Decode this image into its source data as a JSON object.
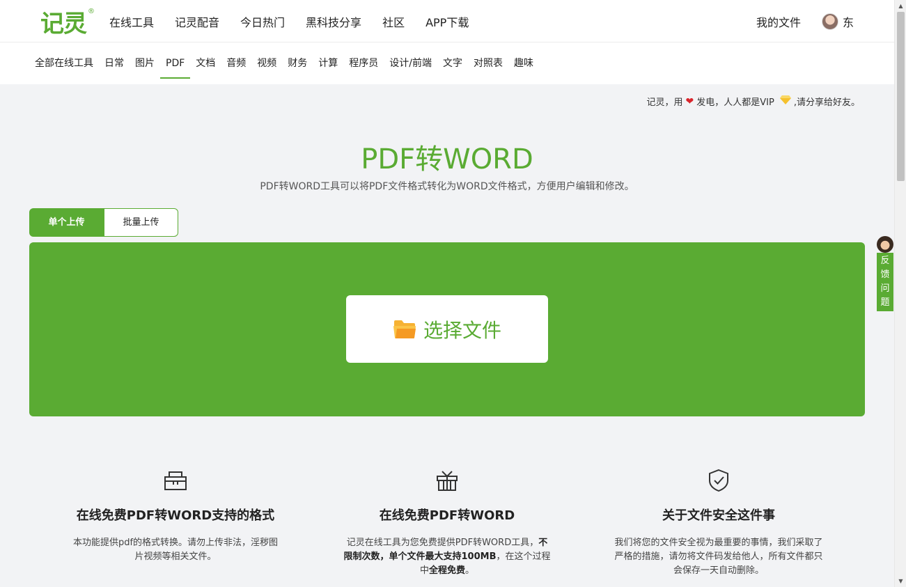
{
  "header": {
    "logo": "记灵",
    "logo_mark": "®",
    "nav": [
      "在线工具",
      "记灵配音",
      "今日热门",
      "黑科技分享",
      "社区",
      "APP下载"
    ],
    "my_files": "我的文件",
    "user_name": "东"
  },
  "categories": {
    "items": [
      "全部在线工具",
      "日常",
      "图片",
      "PDF",
      "文档",
      "音频",
      "视频",
      "财务",
      "计算",
      "程序员",
      "设计/前端",
      "文字",
      "对照表",
      "趣味"
    ],
    "active": "PDF"
  },
  "notice": {
    "part1": "记灵，用",
    "part2": "发电，人人都是VIP",
    "part3": ",请分享给好友。"
  },
  "main": {
    "title": "PDF转WORD",
    "subtitle": "PDF转WORD工具可以将PDF文件格式转化为WORD文件格式，方便用户编辑和修改。",
    "tabs": [
      "单个上传",
      "批量上传"
    ],
    "choose_file": "选择文件"
  },
  "features": [
    {
      "icon": "box-icon",
      "title": "在线免费PDF转WORD支持的格式",
      "text1": "本功能提供pdf的格式转换。请勿上传非法，淫秽图片视频等相关文件。"
    },
    {
      "icon": "gift-icon",
      "title": "在线免费PDF转WORD",
      "text1": "记灵在线工具为您免费提供PDF转WORD工具，",
      "bold1": "不限制次数，单个文件最大支持100MB",
      "text2": "，在这个过程中",
      "bold2": "全程免费",
      "text3": "。"
    },
    {
      "icon": "shield-check-icon",
      "title": "关于文件安全这件事",
      "text1": "我们将您的文件安全视为最重要的事情，我们采取了严格的措施，请勿将文件码发给他人，所有文件都只会保存一天自动删除。"
    }
  ],
  "feedback": {
    "label": [
      "反",
      "馈",
      "问",
      "题"
    ]
  },
  "colors": {
    "accent": "#5aab33",
    "background": "#f2f3f5"
  }
}
